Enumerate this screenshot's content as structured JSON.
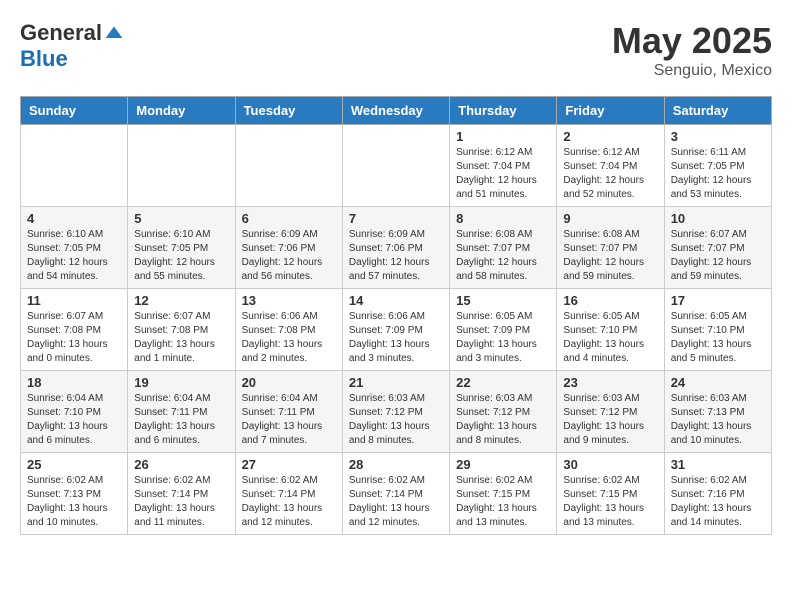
{
  "logo": {
    "general": "General",
    "blue": "Blue"
  },
  "title": {
    "month_year": "May 2025",
    "location": "Senguio, Mexico"
  },
  "weekdays": [
    "Sunday",
    "Monday",
    "Tuesday",
    "Wednesday",
    "Thursday",
    "Friday",
    "Saturday"
  ],
  "weeks": [
    [
      {
        "day": "",
        "info": ""
      },
      {
        "day": "",
        "info": ""
      },
      {
        "day": "",
        "info": ""
      },
      {
        "day": "",
        "info": ""
      },
      {
        "day": "1",
        "info": "Sunrise: 6:12 AM\nSunset: 7:04 PM\nDaylight: 12 hours and 51 minutes."
      },
      {
        "day": "2",
        "info": "Sunrise: 6:12 AM\nSunset: 7:04 PM\nDaylight: 12 hours and 52 minutes."
      },
      {
        "day": "3",
        "info": "Sunrise: 6:11 AM\nSunset: 7:05 PM\nDaylight: 12 hours and 53 minutes."
      }
    ],
    [
      {
        "day": "4",
        "info": "Sunrise: 6:10 AM\nSunset: 7:05 PM\nDaylight: 12 hours and 54 minutes."
      },
      {
        "day": "5",
        "info": "Sunrise: 6:10 AM\nSunset: 7:05 PM\nDaylight: 12 hours and 55 minutes."
      },
      {
        "day": "6",
        "info": "Sunrise: 6:09 AM\nSunset: 7:06 PM\nDaylight: 12 hours and 56 minutes."
      },
      {
        "day": "7",
        "info": "Sunrise: 6:09 AM\nSunset: 7:06 PM\nDaylight: 12 hours and 57 minutes."
      },
      {
        "day": "8",
        "info": "Sunrise: 6:08 AM\nSunset: 7:07 PM\nDaylight: 12 hours and 58 minutes."
      },
      {
        "day": "9",
        "info": "Sunrise: 6:08 AM\nSunset: 7:07 PM\nDaylight: 12 hours and 59 minutes."
      },
      {
        "day": "10",
        "info": "Sunrise: 6:07 AM\nSunset: 7:07 PM\nDaylight: 12 hours and 59 minutes."
      }
    ],
    [
      {
        "day": "11",
        "info": "Sunrise: 6:07 AM\nSunset: 7:08 PM\nDaylight: 13 hours and 0 minutes."
      },
      {
        "day": "12",
        "info": "Sunrise: 6:07 AM\nSunset: 7:08 PM\nDaylight: 13 hours and 1 minute."
      },
      {
        "day": "13",
        "info": "Sunrise: 6:06 AM\nSunset: 7:08 PM\nDaylight: 13 hours and 2 minutes."
      },
      {
        "day": "14",
        "info": "Sunrise: 6:06 AM\nSunset: 7:09 PM\nDaylight: 13 hours and 3 minutes."
      },
      {
        "day": "15",
        "info": "Sunrise: 6:05 AM\nSunset: 7:09 PM\nDaylight: 13 hours and 3 minutes."
      },
      {
        "day": "16",
        "info": "Sunrise: 6:05 AM\nSunset: 7:10 PM\nDaylight: 13 hours and 4 minutes."
      },
      {
        "day": "17",
        "info": "Sunrise: 6:05 AM\nSunset: 7:10 PM\nDaylight: 13 hours and 5 minutes."
      }
    ],
    [
      {
        "day": "18",
        "info": "Sunrise: 6:04 AM\nSunset: 7:10 PM\nDaylight: 13 hours and 6 minutes."
      },
      {
        "day": "19",
        "info": "Sunrise: 6:04 AM\nSunset: 7:11 PM\nDaylight: 13 hours and 6 minutes."
      },
      {
        "day": "20",
        "info": "Sunrise: 6:04 AM\nSunset: 7:11 PM\nDaylight: 13 hours and 7 minutes."
      },
      {
        "day": "21",
        "info": "Sunrise: 6:03 AM\nSunset: 7:12 PM\nDaylight: 13 hours and 8 minutes."
      },
      {
        "day": "22",
        "info": "Sunrise: 6:03 AM\nSunset: 7:12 PM\nDaylight: 13 hours and 8 minutes."
      },
      {
        "day": "23",
        "info": "Sunrise: 6:03 AM\nSunset: 7:12 PM\nDaylight: 13 hours and 9 minutes."
      },
      {
        "day": "24",
        "info": "Sunrise: 6:03 AM\nSunset: 7:13 PM\nDaylight: 13 hours and 10 minutes."
      }
    ],
    [
      {
        "day": "25",
        "info": "Sunrise: 6:02 AM\nSunset: 7:13 PM\nDaylight: 13 hours and 10 minutes."
      },
      {
        "day": "26",
        "info": "Sunrise: 6:02 AM\nSunset: 7:14 PM\nDaylight: 13 hours and 11 minutes."
      },
      {
        "day": "27",
        "info": "Sunrise: 6:02 AM\nSunset: 7:14 PM\nDaylight: 13 hours and 12 minutes."
      },
      {
        "day": "28",
        "info": "Sunrise: 6:02 AM\nSunset: 7:14 PM\nDaylight: 13 hours and 12 minutes."
      },
      {
        "day": "29",
        "info": "Sunrise: 6:02 AM\nSunset: 7:15 PM\nDaylight: 13 hours and 13 minutes."
      },
      {
        "day": "30",
        "info": "Sunrise: 6:02 AM\nSunset: 7:15 PM\nDaylight: 13 hours and 13 minutes."
      },
      {
        "day": "31",
        "info": "Sunrise: 6:02 AM\nSunset: 7:16 PM\nDaylight: 13 hours and 14 minutes."
      }
    ]
  ]
}
